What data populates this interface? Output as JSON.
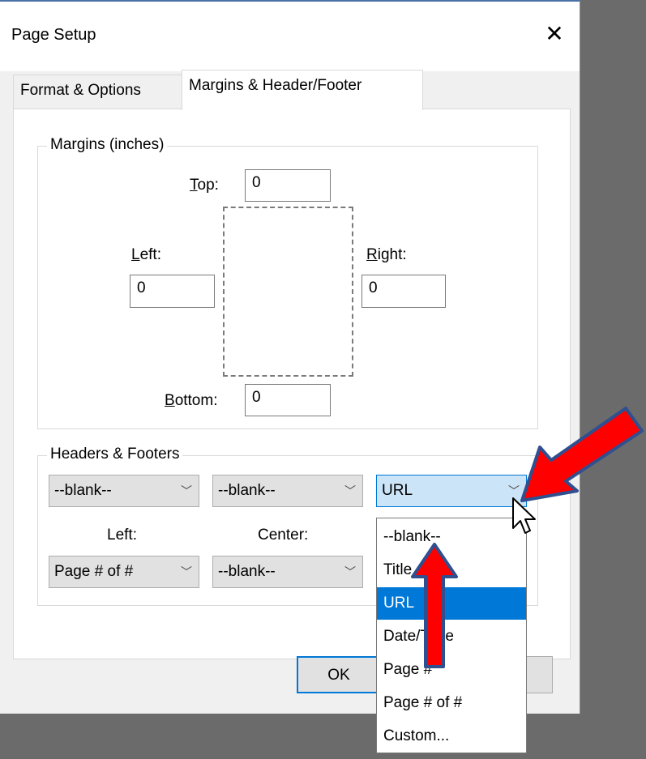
{
  "window": {
    "title": "Page Setup"
  },
  "tabs": [
    {
      "label": "Format & Options"
    },
    {
      "label": "Margins & Header/Footer"
    }
  ],
  "margins": {
    "legend": "Margins (inches)",
    "top_label": "Top:",
    "top_value": "0",
    "left_label": "Left:",
    "left_value": "0",
    "right_label": "Right:",
    "right_value": "0",
    "bottom_label": "Bottom:",
    "bottom_value": "0"
  },
  "headers_footers": {
    "legend": "Headers & Footers",
    "header_left": "--blank--",
    "header_center": "--blank--",
    "header_right": "URL",
    "left_label": "Left:",
    "center_label": "Center:",
    "footer_left": "Page # of #",
    "footer_center": "--blank--"
  },
  "dropdown": {
    "options": [
      "--blank--",
      "Title",
      "URL",
      "Date/Time",
      "Page #",
      "Page # of #",
      "Custom..."
    ],
    "selected": "URL"
  },
  "buttons": {
    "ok": "OK"
  },
  "icons": {
    "close": "close-icon",
    "chevron": "chevron-down-icon",
    "cursor": "mouse-cursor-icon",
    "annotation": "red-arrow-icon"
  },
  "colors": {
    "accent": "#0078d7",
    "annotation_fill": "#ff0000",
    "annotation_stroke": "#2f4f8f"
  }
}
